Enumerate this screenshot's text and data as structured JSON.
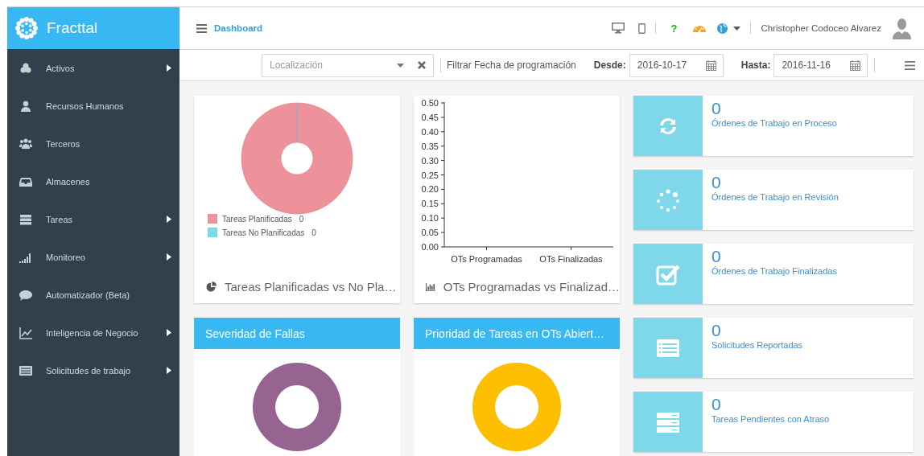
{
  "brand": {
    "name": "Fracttal"
  },
  "sidebar": {
    "items": [
      {
        "label": "Activos",
        "has_submenu": true
      },
      {
        "label": "Recursos Humanos",
        "has_submenu": false
      },
      {
        "label": "Terceros",
        "has_submenu": false
      },
      {
        "label": "Almacenes",
        "has_submenu": false
      },
      {
        "label": "Tareas",
        "has_submenu": true
      },
      {
        "label": "Monitoreo",
        "has_submenu": true
      },
      {
        "label": "Automatizador (Beta)",
        "has_submenu": false
      },
      {
        "label": "Inteligencia de Negocio",
        "has_submenu": true
      },
      {
        "label": "Solicitudes de trabajo",
        "has_submenu": true
      }
    ]
  },
  "header": {
    "page_title": "Dashboard",
    "help": "?",
    "user_name": "Christopher Codoceo Alvarez"
  },
  "filter_bar": {
    "location": {
      "placeholder": "Localización"
    },
    "date_filter_label": "Filtrar Fecha de programación",
    "from": {
      "label": "Desde:",
      "value": "2016-10-17"
    },
    "to": {
      "label": "Hasta:",
      "value": "2016-11-16"
    }
  },
  "task_card": {
    "title": "Tareas Planificadas vs No Pla…",
    "legend": [
      {
        "label": "Tareas Planificadas",
        "value": "0",
        "color": "#ed919b"
      },
      {
        "label": "Tareas No Planificadas",
        "value": "0",
        "color": "#7fd8ea"
      }
    ]
  },
  "ot_card": {
    "title": "OTs Programadas vs Finalizad…",
    "chart_data": {
      "type": "bar",
      "categories": [
        "OTs Programadas",
        "OTs Finalizadas"
      ],
      "values": [
        0,
        0
      ],
      "ylim": [
        0,
        0.5
      ],
      "yticks": [
        {
          "value": 0,
          "label": "0.00"
        },
        {
          "value": 0.05,
          "label": "0.05"
        },
        {
          "value": 0.1,
          "label": "0.10"
        },
        {
          "value": 0.15,
          "label": "0.15"
        },
        {
          "value": 0.2,
          "label": "0.20"
        },
        {
          "value": 0.25,
          "label": "0.25"
        },
        {
          "value": 0.3,
          "label": "0.30"
        },
        {
          "value": 0.35,
          "label": "0.35"
        },
        {
          "value": 0.4,
          "label": "0.40"
        },
        {
          "value": 0.45,
          "label": "0.45"
        },
        {
          "value": 0.5,
          "label": "0.50"
        }
      ]
    }
  },
  "stats": [
    {
      "value": "0",
      "label": "Órdenes de Trabajo en Proceso"
    },
    {
      "value": "0",
      "label": "Órdenes de Trabajo en Revisión"
    },
    {
      "value": "0",
      "label": "Órdenes de Trabajo Finalizadas"
    },
    {
      "value": "0",
      "label": "Solicitudes Reportadas"
    },
    {
      "value": "0",
      "label": "Tareas Pendientes con Atraso"
    }
  ],
  "panels": [
    {
      "title": "Severidad de Fallas",
      "color": "#976390"
    },
    {
      "title": "Prioridad de Tareas en OTs Abiert…",
      "color": "#fdbf00"
    }
  ]
}
